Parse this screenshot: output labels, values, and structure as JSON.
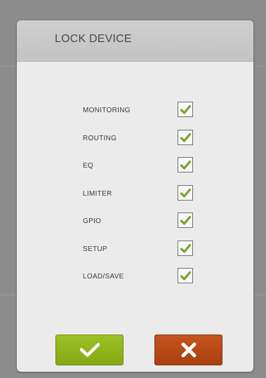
{
  "dialog": {
    "title": "LOCK DEVICE"
  },
  "options": [
    {
      "label": "MONITORING",
      "checked": true
    },
    {
      "label": "ROUTING",
      "checked": true
    },
    {
      "label": "EQ",
      "checked": true
    },
    {
      "label": "LIMITER",
      "checked": true
    },
    {
      "label": "GPIO",
      "checked": true
    },
    {
      "label": "SETUP",
      "checked": true
    },
    {
      "label": "LOAD/SAVE",
      "checked": true
    }
  ],
  "buttons": {
    "confirm_icon": "check-icon",
    "cancel_icon": "x-icon"
  },
  "colors": {
    "check_mark": "#76a52a",
    "confirm_button": "#92b61f",
    "cancel_button": "#b74918",
    "header": "#c9c9c9",
    "dialog_bg": "#ebebeb"
  }
}
